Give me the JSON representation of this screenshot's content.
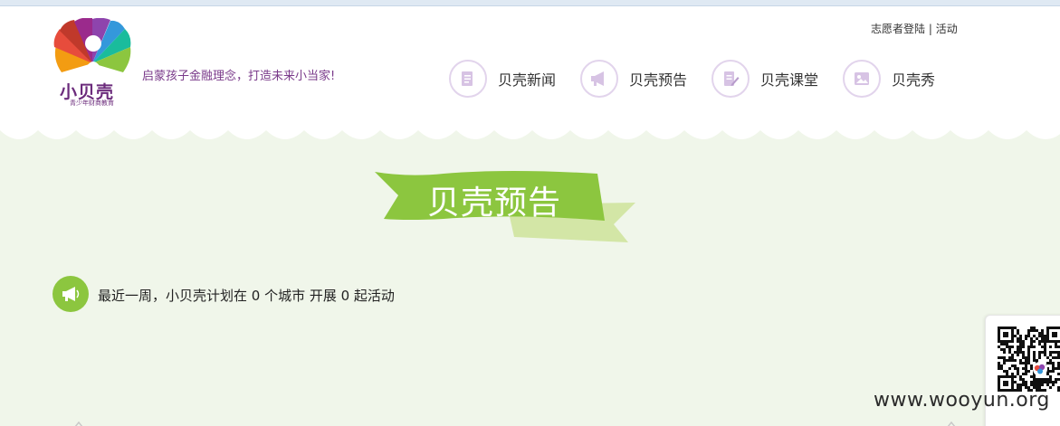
{
  "header": {
    "logo": {
      "brand": "小贝壳",
      "tagline": "青少年财商教育",
      "icon": "shell-logo"
    },
    "slogan": "启蒙孩子金融理念，打造未来小当家!",
    "top_links": {
      "login": "志愿者登陆",
      "separator": " | ",
      "activity": "活动"
    },
    "nav": [
      {
        "label": "贝壳新闻",
        "icon": "document-icon"
      },
      {
        "label": "贝壳预告",
        "icon": "megaphone-icon"
      },
      {
        "label": "贝壳课堂",
        "icon": "edit-note-icon"
      },
      {
        "label": "贝壳秀",
        "icon": "picture-icon"
      }
    ]
  },
  "section": {
    "title": "贝壳预告",
    "notice": "最近一周，小贝壳计划在 0 个城市 开展 0 起活动",
    "notice_icon": "megaphone-icon"
  },
  "sidebar": {
    "qr_icon": "qr-code-icon"
  },
  "watermark": "www.wooyun.org",
  "colors": {
    "accent_green": "#8cc63f",
    "brand_purple": "#7a3a8a",
    "page_bg": "#f0f6ea"
  }
}
